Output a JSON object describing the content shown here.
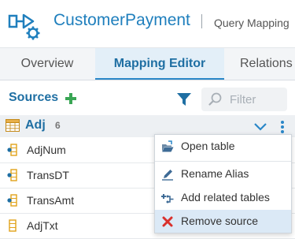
{
  "header": {
    "title": "CustomerPayment",
    "separator": "|",
    "breadcrumb": "Query Mapping"
  },
  "tabs": [
    {
      "label": "Overview"
    },
    {
      "label": "Mapping Editor",
      "active": true
    },
    {
      "label": "Relations"
    }
  ],
  "sources": {
    "title": "Sources",
    "filter_placeholder": "Filter"
  },
  "table": {
    "name": "Adj",
    "count": "6"
  },
  "fields": [
    {
      "label": "AdjNum"
    },
    {
      "label": "TransDT"
    },
    {
      "label": "TransAmt"
    },
    {
      "label": "AdjTxt"
    }
  ],
  "menu": {
    "items": [
      {
        "label": "Open table",
        "icon": "open-folder-icon"
      },
      {
        "label": "Rename Alias",
        "icon": "pencil-icon"
      },
      {
        "label": "Add related tables",
        "icon": "add-relation-icon"
      },
      {
        "label": "Remove source",
        "icon": "remove-x-icon",
        "highlighted": true
      }
    ]
  },
  "colors": {
    "accent": "#1f7fbd",
    "add": "#3aa655",
    "remove": "#d9302c",
    "field_icon": "#e0a21a"
  }
}
